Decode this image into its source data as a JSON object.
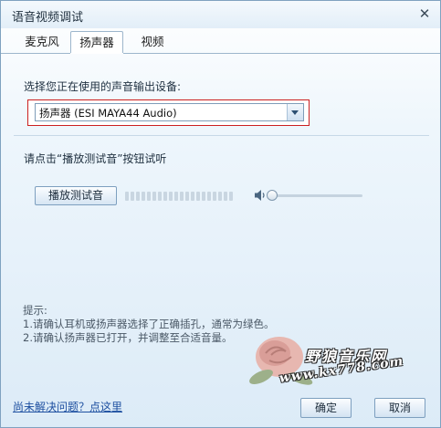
{
  "window": {
    "title": "语音视频调试"
  },
  "tabs": [
    {
      "label": "麦克风",
      "active": false
    },
    {
      "label": "扬声器",
      "active": true
    },
    {
      "label": "视频",
      "active": false
    }
  ],
  "speaker": {
    "select_label": "选择您正在使用的声音输出设备:",
    "device_value": "扬声器 (ESI MAYA44 Audio)",
    "test_label": "请点击“播放测试音”按钮试听",
    "play_button": "播放测试音",
    "volume_level": 0.0
  },
  "tips": {
    "heading": "提示:",
    "lines": [
      "1.请确认耳机或扬声器选择了正确插孔，通常为绿色。",
      "2.请确认扬声器已打开，并调整至合适音量。"
    ]
  },
  "watermark": {
    "name": "野狼音乐网",
    "url": "www.kx778.com"
  },
  "footer": {
    "help_link": "尚未解决问题？点这里",
    "ok": "确定",
    "cancel": "取消"
  },
  "colors": {
    "highlight": "#cc2020",
    "link": "#1d4fa0"
  }
}
